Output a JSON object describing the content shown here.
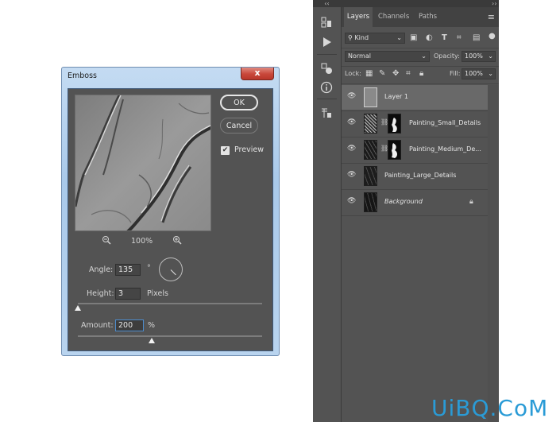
{
  "dialog": {
    "title": "Emboss",
    "close_label": "x",
    "ok_label": "OK",
    "cancel_label": "Cancel",
    "preview_label": "Preview",
    "preview_checked": true,
    "zoom_out_icon": "zoom-out-icon",
    "zoom_in_icon": "zoom-in-icon",
    "zoom_value": "100%",
    "angle": {
      "label": "Angle:",
      "value": "135",
      "unit": "°"
    },
    "height": {
      "label": "Height:",
      "value": "3",
      "unit": "Pixels",
      "slider_fraction": 0.0
    },
    "amount": {
      "label": "Amount:",
      "value": "200",
      "unit": "%",
      "slider_fraction": 0.4
    }
  },
  "toolbar": {
    "collapse_label": "‹‹",
    "icons": [
      "layer-comps-icon",
      "play-icon",
      "adjustments-icon",
      "info-icon",
      "character-style-icon"
    ]
  },
  "panel": {
    "collapse_label": "››",
    "tabs": [
      "Layers",
      "Channels",
      "Paths"
    ],
    "active_tab": "Layers",
    "filter_kind": "Kind",
    "blend_mode": "Normal",
    "opacity_label": "Opacity:",
    "opacity_value": "100%",
    "lock_label": "Lock:",
    "fill_label": "Fill:",
    "fill_value": "100%",
    "layers": [
      {
        "name": "Layer 1",
        "selected": true,
        "mask": false,
        "italic": false,
        "locked": false
      },
      {
        "name": "Painting_Small_Details",
        "selected": false,
        "mask": true,
        "italic": false,
        "locked": false
      },
      {
        "name": "Painting_Medium_De...",
        "selected": false,
        "mask": true,
        "italic": false,
        "locked": false
      },
      {
        "name": "Painting_Large_Details",
        "selected": false,
        "mask": false,
        "italic": false,
        "locked": false
      },
      {
        "name": "Background",
        "selected": false,
        "mask": false,
        "italic": true,
        "locked": true
      }
    ]
  },
  "watermark": "UiBQ.CoM"
}
